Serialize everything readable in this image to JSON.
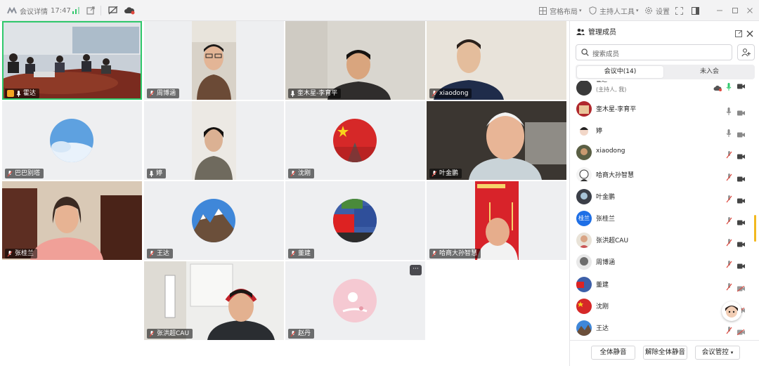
{
  "titlebar": {
    "meeting_details": "会议详情",
    "time": "17:47",
    "layout": "宫格布局",
    "host_tools": "主持人工具",
    "settings": "设置"
  },
  "tiles": [
    {
      "name": "霍达"
    },
    {
      "name": "周博涵"
    },
    {
      "name": "奎木星-李育平"
    },
    {
      "name": "xiaodong"
    },
    {
      "name": "巴巴别塔"
    },
    {
      "name": "婷"
    },
    {
      "name": "沈刚"
    },
    {
      "name": "叶金鹏"
    },
    {
      "name": "张桂兰"
    },
    {
      "name": "王达"
    },
    {
      "name": "董建"
    },
    {
      "name": "哈商大孙智慧"
    },
    {
      "name": "张洪超CAU"
    },
    {
      "name": "赵丹"
    }
  ],
  "panel": {
    "title": "管理成员",
    "search_placeholder": "搜索成员",
    "tab_in_meeting": "会议中(14)",
    "tab_not_joined": "未入会",
    "partial_name": "霍达",
    "partial_sub": "(主持人, 我)",
    "avatar_text_gl": "桂兰",
    "members": [
      {
        "name": "奎木星-李育平"
      },
      {
        "name": "婷"
      },
      {
        "name": "xiaodong"
      },
      {
        "name": "哈商大孙智慧"
      },
      {
        "name": "叶金鹏"
      },
      {
        "name": "张桂兰"
      },
      {
        "name": "张洪超CAU"
      },
      {
        "name": "周博涵"
      },
      {
        "name": "董建"
      },
      {
        "name": "沈刚"
      },
      {
        "name": "王达"
      }
    ],
    "mute_all": "全体静音",
    "unmute_all": "解除全体静音",
    "meeting_control": "会议管控"
  },
  "colors": {
    "accent": "#2fc86b",
    "blue": "#1e6fe6",
    "muted_red": "#e0483e"
  }
}
